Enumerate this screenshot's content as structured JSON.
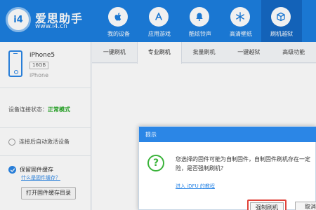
{
  "app": {
    "name": "爱思助手",
    "url": "www.i4.cn",
    "badge": "i4",
    "colors": {
      "brand": "#1c7fe0",
      "nav_active": "#1569c4",
      "accent": "#2b86e6",
      "ok_green": "#29a829",
      "highlight_red": "#e0433a"
    }
  },
  "nav": [
    {
      "label": "我的设备",
      "icon": "apple-icon",
      "active": false
    },
    {
      "label": "应用游戏",
      "icon": "app-store-icon",
      "active": false
    },
    {
      "label": "酷炫铃声",
      "icon": "bell-icon",
      "active": false
    },
    {
      "label": "高清壁纸",
      "icon": "snowflake-icon",
      "active": false
    },
    {
      "label": "刷机越狱",
      "icon": "box-icon",
      "active": true
    }
  ],
  "sidebar": {
    "device": {
      "name": "iPhone5",
      "capacity": "16GB",
      "model": "iPhone",
      "icon": "phone-icon"
    },
    "connection_label": "设备连接状态：",
    "connection_value": "正常模式",
    "auto_activate_label": "连接后自动激活设备",
    "keep_cache_label": "保留固件缓存",
    "cache_help_link": "什么是固件缓存？",
    "open_cache_button": "打开固件缓存目录"
  },
  "tabs": [
    {
      "label": "一键刷机",
      "active": false
    },
    {
      "label": "专业刷机",
      "active": true
    },
    {
      "label": "批量刷机",
      "active": false
    },
    {
      "label": "一键越狱",
      "active": false
    },
    {
      "label": "高级功能",
      "active": false
    }
  ],
  "dialog": {
    "title": "提示",
    "icon": "question-icon",
    "icon_glyph": "?",
    "message": "您选择的固件可能为自制固件，自制固件刷机存在一定\n险，是否强制刷机？",
    "link": "进入 iDFU 的教程",
    "force_button": "强制刷机",
    "cancel_button": "取消"
  }
}
